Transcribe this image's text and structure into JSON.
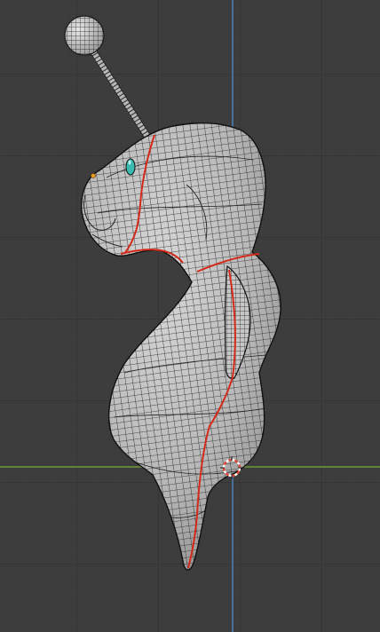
{
  "viewport": {
    "background": "#3d3d3d",
    "grid_color": "#333333",
    "x_axis_color": "#6e9a3c",
    "y_axis_color": "#4f7fb3"
  },
  "model": {
    "shading": "solid",
    "wireframe_overlay": true,
    "surface_color": "#bdbdbd",
    "wire_color": "#1a1a1a",
    "seam_color": "#d42a1a",
    "eye_color": "#3ab9b0",
    "antenna_ball_color": "#cfcfcf"
  },
  "cursor_3d": {
    "icon": "3d-cursor-icon",
    "color": "#e24a3a"
  },
  "selected_vertex_color": "#e8a020"
}
